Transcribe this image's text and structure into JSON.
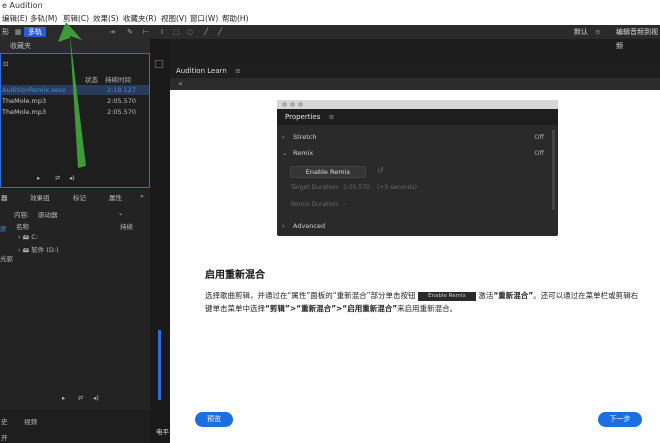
{
  "window": {
    "title": "e Audition"
  },
  "menu": {
    "items": [
      "编辑(E)",
      "多轨(M)",
      "剪辑(C)",
      "效果(S)",
      "收藏夹(R)",
      "视图(V)",
      "窗口(W)",
      "帮助(H)"
    ]
  },
  "toolbar": {
    "mode_left": "形",
    "mode_active": "多轨",
    "right_a": "默认",
    "right_b": "编辑音频到视频"
  },
  "left_panel": {
    "tab": "收藏夹",
    "col_state": "状态",
    "col_duration": "持续时间",
    "files": [
      {
        "name": "AuditionRemix.sesx",
        "duration": "2:18.127"
      },
      {
        "name": "TheMole.mp3",
        "duration": "2:05.570"
      },
      {
        "name": "TheMole.mp3",
        "duration": "2:05.570"
      }
    ]
  },
  "media_panel": {
    "tabs": [
      "器",
      "效果组",
      "标记",
      "属性"
    ],
    "content_label": "内容:",
    "content_value": "驱动器",
    "col_name": "名称",
    "col_duration": "持续",
    "drives": [
      "C:",
      "软件 (D:)"
    ],
    "side_items": [
      "原",
      "光驱"
    ]
  },
  "bottom_left": {
    "tab_a": "史",
    "tab_b": "视频",
    "status": "开"
  },
  "learn_panel": {
    "title": "Audition Learn",
    "properties": {
      "header": "Properties",
      "rows": [
        {
          "label": "Stretch",
          "value": "Off"
        },
        {
          "label": "Remix",
          "value": "Off"
        }
      ],
      "enable_remix": "Enable Remix",
      "target_duration_label": "Target Duration:",
      "target_duration_value": "2:05.570",
      "target_duration_extra": "(+5 seconds)",
      "remix_duration_label": "Remix Duration:",
      "remix_duration_value": "-",
      "advanced": "Advanced"
    },
    "heading": "启用重新混合",
    "para_part1": "选择歌曲剪辑，并通过在“属性”面板的“重新混合”部分单击按钮",
    "inline_button": "Enable Remix",
    "para_part2": "激活",
    "para_bold1": "“重新混合”",
    "para_part3": "。还可以通过在菜单栏或剪辑右键单击菜单中选择",
    "para_bold2": "“剪辑”>“重新混合”>“启用重新混合”",
    "para_part4": "来启用重新混合。",
    "prev_label": "预览",
    "next_label": "下一步"
  },
  "bottom_strip": {
    "label": "电平"
  },
  "colors": {
    "accent": "#1c6fe0",
    "selection_border": "#2d6fd6",
    "arrow": "#3f9b3a"
  }
}
